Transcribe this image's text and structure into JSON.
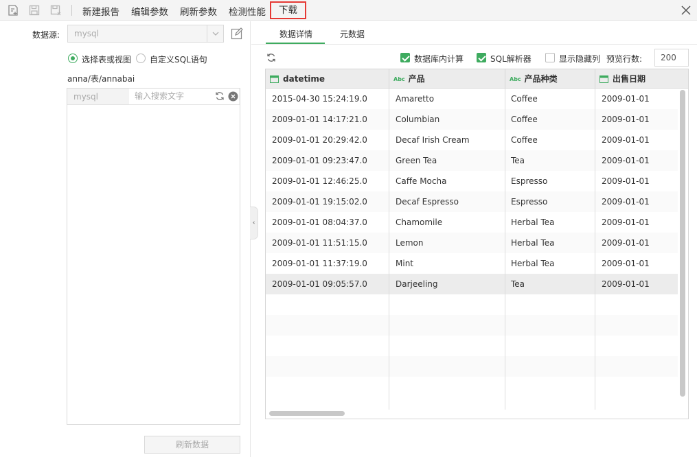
{
  "toolbar": {
    "icons": [
      "new-report-icon",
      "save-icon",
      "save-as-icon"
    ],
    "items": [
      "新建报告",
      "编辑参数",
      "刷新参数",
      "检测性能"
    ],
    "download_label": "下载",
    "close_icon": "close-icon"
  },
  "left": {
    "source_label": "数据源:",
    "source_value": "mysql",
    "radio_table": "选择表或视图",
    "radio_sql": "自定义SQL语句",
    "selected_mode": "选择表或视图",
    "path": "anna/表/annabai",
    "tree_db": "mysql",
    "search_placeholder": "输入搜索文字",
    "refresh_button": "刷新数据"
  },
  "right": {
    "tabs": [
      "数据详情",
      "元数据"
    ],
    "active_tab": "数据详情",
    "options": [
      {
        "label": "数据库内计算",
        "checked": true
      },
      {
        "label": "SQL解析器",
        "checked": true
      },
      {
        "label": "显示隐藏列",
        "checked": false
      }
    ],
    "preview_label": "预览行数:",
    "preview_value": "200"
  },
  "table": {
    "columns": [
      {
        "name": "datetime",
        "type": "date"
      },
      {
        "name": "产品",
        "type": "text"
      },
      {
        "name": "产品种类",
        "type": "text"
      },
      {
        "name": "出售日期",
        "type": "date"
      }
    ],
    "rows": [
      [
        "2015-04-30 15:24:19.0",
        "Amaretto",
        "Coffee",
        "2009-01-01"
      ],
      [
        "2009-01-01 14:17:21.0",
        "Columbian",
        "Coffee",
        "2009-01-01"
      ],
      [
        "2009-01-01 20:29:42.0",
        "Decaf Irish Cream",
        "Coffee",
        "2009-01-01"
      ],
      [
        "2009-01-01 09:23:47.0",
        "Green Tea",
        "Tea",
        "2009-01-01"
      ],
      [
        "2009-01-01 12:46:25.0",
        "Caffe Mocha",
        "Espresso",
        "2009-01-01"
      ],
      [
        "2009-01-01 19:15:02.0",
        "Decaf Espresso",
        "Espresso",
        "2009-01-01"
      ],
      [
        "2009-01-01 08:04:37.0",
        "Chamomile",
        "Herbal Tea",
        "2009-01-01"
      ],
      [
        "2009-01-01 11:51:15.0",
        "Lemon",
        "Herbal Tea",
        "2009-01-01"
      ],
      [
        "2009-01-01 11:37:19.0",
        "Mint",
        "Herbal Tea",
        "2009-01-01"
      ],
      [
        "2009-01-01 09:05:57.0",
        "Darjeeling",
        "Tea",
        "2009-01-01"
      ]
    ],
    "selected_row": 9
  },
  "colors": {
    "accent": "#3eab5f",
    "highlight_border": "#e53935"
  }
}
